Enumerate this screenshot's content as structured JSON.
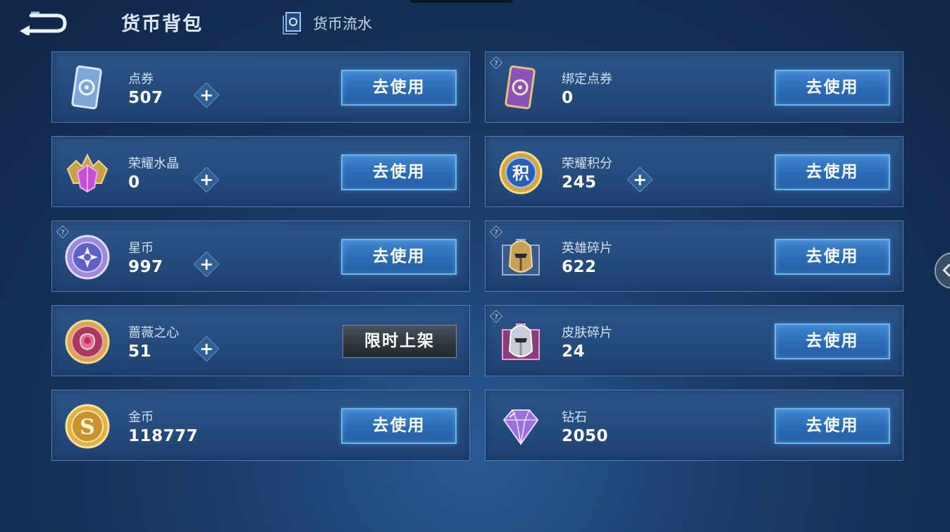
{
  "header": {
    "title": "货币背包",
    "flow_link": "货币流水"
  },
  "actions": {
    "use_label": "去使用",
    "limited_label": "限时上架",
    "plus_glyph": "+"
  },
  "currencies": [
    {
      "name": "点券",
      "amount": "507",
      "icon": "coupon-card-icon"
    },
    {
      "name": "绑定点券",
      "amount": "0",
      "icon": "bound-coupon-card-icon"
    },
    {
      "name": "荣耀水晶",
      "amount": "0",
      "icon": "glory-crystal-icon"
    },
    {
      "name": "荣耀积分",
      "amount": "245",
      "icon": "glory-points-icon",
      "badge_char": "积"
    },
    {
      "name": "星币",
      "amount": "997",
      "icon": "star-coin-icon"
    },
    {
      "name": "英雄碎片",
      "amount": "622",
      "icon": "hero-fragment-icon"
    },
    {
      "name": "蔷薇之心",
      "amount": "51",
      "icon": "rose-heart-icon"
    },
    {
      "name": "皮肤碎片",
      "amount": "24",
      "icon": "skin-fragment-icon"
    },
    {
      "name": "金币",
      "amount": "118777",
      "icon": "gold-coin-icon",
      "badge_char": "S"
    },
    {
      "name": "钻石",
      "amount": "2050",
      "icon": "diamond-icon"
    }
  ],
  "colors": {
    "accent_blue": "#3f86d0",
    "background": "#1c3f6d",
    "gold": "#e0b248"
  }
}
